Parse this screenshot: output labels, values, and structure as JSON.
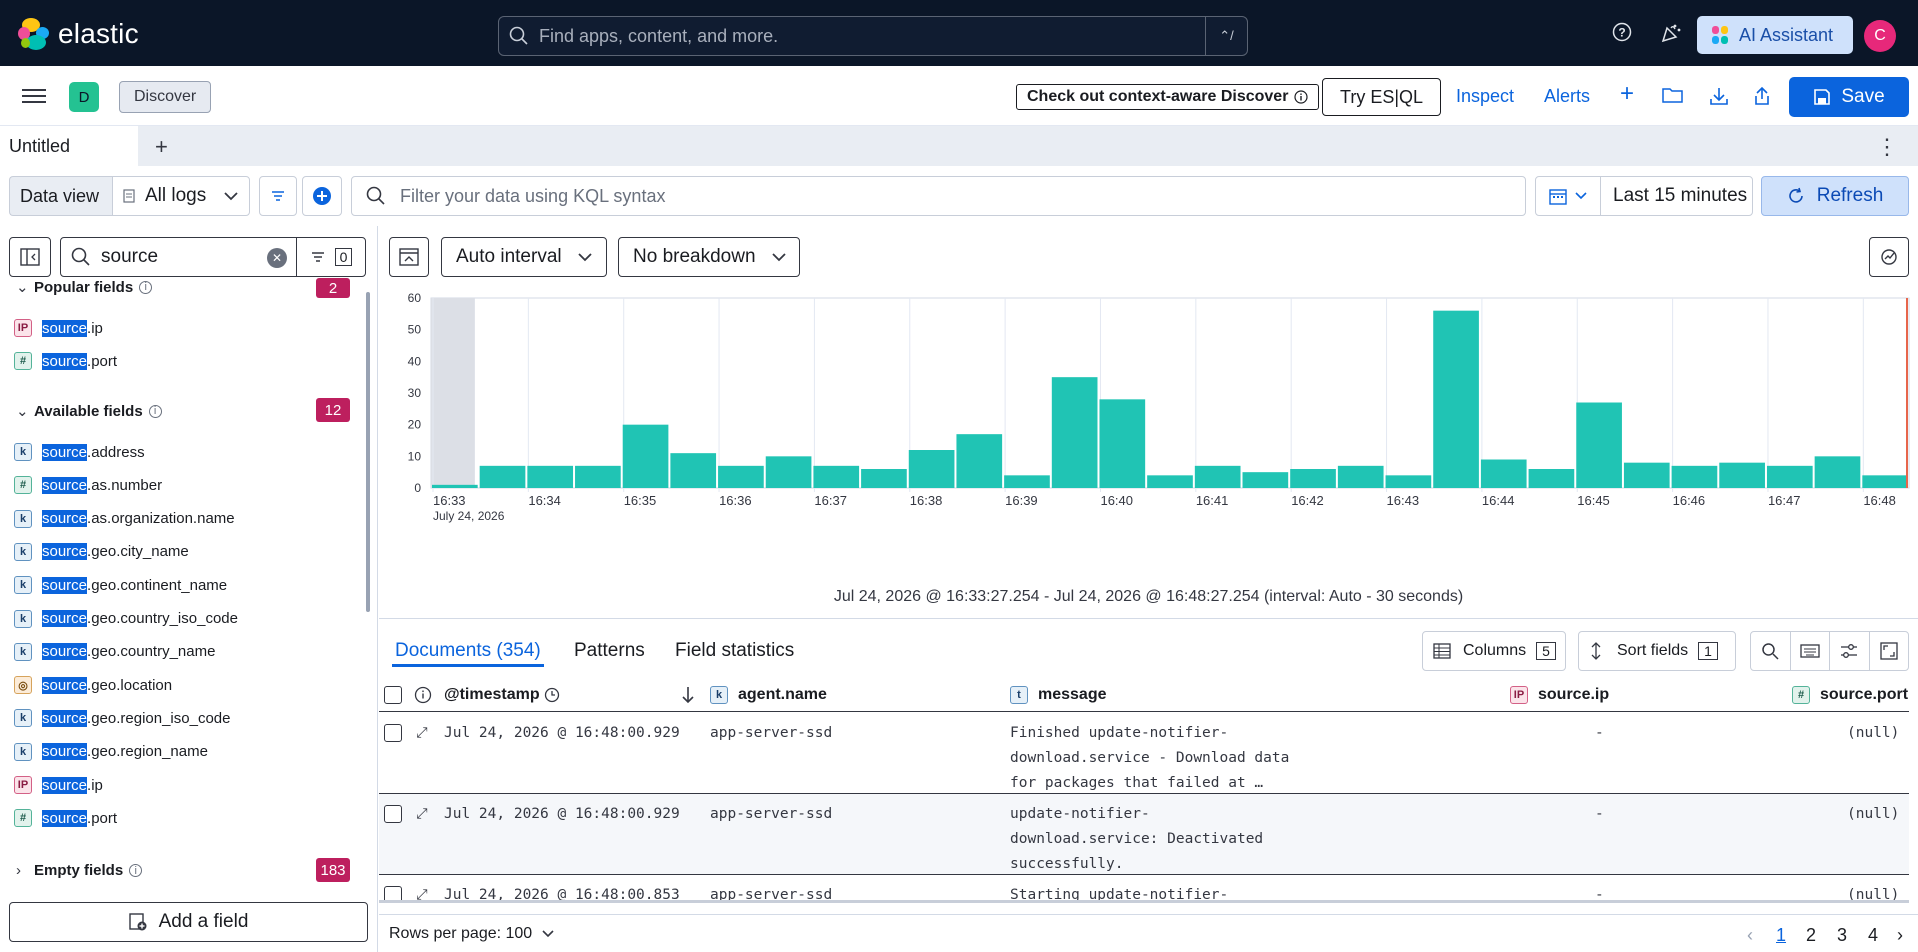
{
  "topbar": {
    "brand": "elastic",
    "search_placeholder": "Find apps, content, and more.",
    "search_shortcut": "⌃/",
    "ai_assistant": "AI Assistant",
    "avatar_initial": "C"
  },
  "appbar": {
    "space_initial": "D",
    "breadcrumb": "Discover",
    "context_notice": "Check out context-aware Discover",
    "try_esql": "Try ES|QL",
    "inspect": "Inspect",
    "alerts": "Alerts",
    "save": "Save"
  },
  "tabs": {
    "active": "Untitled"
  },
  "query": {
    "data_view_label": "Data view",
    "data_view_value": "All logs",
    "kql_placeholder": "Filter your data using KQL syntax",
    "time_range": "Last 15 minutes",
    "refresh": "Refresh"
  },
  "sidebar": {
    "search_value": "source",
    "filter_count": "0",
    "popular": {
      "label": "Popular fields",
      "count": "2",
      "fields": [
        {
          "type": "ip",
          "match": "source",
          "rest": ".ip"
        },
        {
          "type": "number",
          "match": "source",
          "rest": ".port"
        }
      ]
    },
    "available": {
      "label": "Available fields",
      "count": "12",
      "fields": [
        {
          "type": "keyword",
          "match": "source",
          "rest": ".address"
        },
        {
          "type": "number",
          "match": "source",
          "rest": ".as.number"
        },
        {
          "type": "keyword",
          "match": "source",
          "rest": ".as.organization.name"
        },
        {
          "type": "keyword",
          "match": "source",
          "rest": ".geo.city_name"
        },
        {
          "type": "keyword",
          "match": "source",
          "rest": ".geo.continent_name"
        },
        {
          "type": "keyword",
          "match": "source",
          "rest": ".geo.country_iso_code"
        },
        {
          "type": "keyword",
          "match": "source",
          "rest": ".geo.country_name"
        },
        {
          "type": "geo",
          "match": "source",
          "rest": ".geo.location"
        },
        {
          "type": "keyword",
          "match": "source",
          "rest": ".geo.region_iso_code"
        },
        {
          "type": "keyword",
          "match": "source",
          "rest": ".geo.region_name"
        },
        {
          "type": "ip",
          "match": "source",
          "rest": ".ip"
        },
        {
          "type": "number",
          "match": "source",
          "rest": ".port"
        }
      ]
    },
    "empty": {
      "label": "Empty fields",
      "count": "183"
    },
    "add_field": "Add a field"
  },
  "toolbar": {
    "interval": "Auto interval",
    "breakdown": "No breakdown"
  },
  "chart_data": {
    "type": "bar",
    "categories": [
      "16:33:00",
      "16:33:30",
      "16:34:00",
      "16:34:30",
      "16:35:00",
      "16:35:30",
      "16:36:00",
      "16:36:30",
      "16:37:00",
      "16:37:30",
      "16:38:00",
      "16:38:30",
      "16:39:00",
      "16:39:30",
      "16:40:00",
      "16:40:30",
      "16:41:00",
      "16:41:30",
      "16:42:00",
      "16:42:30",
      "16:43:00",
      "16:43:30",
      "16:44:00",
      "16:44:30",
      "16:45:00",
      "16:45:30",
      "16:46:00",
      "16:46:30",
      "16:47:00",
      "16:47:30",
      "16:48:00"
    ],
    "values": [
      1,
      7,
      7,
      7,
      20,
      11,
      7,
      10,
      7,
      6,
      12,
      17,
      4,
      35,
      28,
      4,
      7,
      5,
      6,
      7,
      4,
      56,
      9,
      6,
      27,
      8,
      7,
      8,
      7,
      10,
      4
    ],
    "ylim": [
      0,
      60
    ],
    "yticks": [
      "0",
      "10",
      "20",
      "30",
      "40",
      "50",
      "60"
    ],
    "xticks": [
      "16:33",
      "16:34",
      "16:35",
      "16:36",
      "16:37",
      "16:38",
      "16:39",
      "16:40",
      "16:41",
      "16:42",
      "16:43",
      "16:44",
      "16:45",
      "16:46",
      "16:47",
      "16:48"
    ],
    "date_label": "July 24, 2026",
    "color": "#20c4b4",
    "grid": true
  },
  "range_text": "Jul 24, 2026 @ 16:33:27.254 - Jul 24, 2026 @ 16:48:27.254 (interval: Auto - 30 seconds)",
  "docs": {
    "tab_documents": "Documents (354)",
    "tab_patterns": "Patterns",
    "tab_field_stats": "Field statistics",
    "columns_label": "Columns",
    "columns_count": "5",
    "sort_label": "Sort fields",
    "sort_count": "1",
    "headers": {
      "timestamp": "@timestamp",
      "agent": "agent.name",
      "message": "message",
      "ip": "source.ip",
      "port": "source.port"
    },
    "rows": [
      {
        "ts": "Jul 24, 2026 @ 16:48:00.929",
        "agent": "app-server-ssd",
        "msg1": "Finished update-notifier-",
        "msg2": "download.service - Download data",
        "msg3": "for packages that failed at …",
        "ip": "-",
        "port": "(null)"
      },
      {
        "ts": "Jul 24, 2026 @ 16:48:00.929",
        "agent": "app-server-ssd",
        "msg1": "update-notifier-",
        "msg2": "download.service: Deactivated",
        "msg3": "successfully.",
        "ip": "-",
        "port": "(null)"
      },
      {
        "ts": "Jul 24, 2026 @ 16:48:00.853",
        "agent": "app-server-ssd",
        "msg1": "Starting update-notifier-",
        "msg2": "",
        "msg3": "",
        "ip": "-",
        "port": "(null)"
      }
    ],
    "rows_per_page": "Rows per page: 100",
    "pages": [
      "1",
      "2",
      "3",
      "4"
    ]
  }
}
